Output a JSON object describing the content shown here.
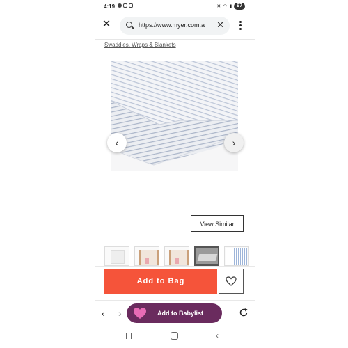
{
  "status_bar": {
    "time": "4:19",
    "battery": "97"
  },
  "browser": {
    "url": "https://www.myer.com.au",
    "url_display": "https://www.myer.com.a"
  },
  "breadcrumb": "Swaddles, Wraps & Blankets",
  "product": {
    "view_similar": "View Similar",
    "thumbnail_count": 5,
    "active_thumbnail": 4
  },
  "actions": {
    "add_to_bag": "Add to Bag",
    "add_to_babylist": "Add to Babylist"
  },
  "colors": {
    "accent_orange": "#f5543a",
    "babylist_purple": "#6a2b5e",
    "heart_pink": "#e76bb5"
  }
}
